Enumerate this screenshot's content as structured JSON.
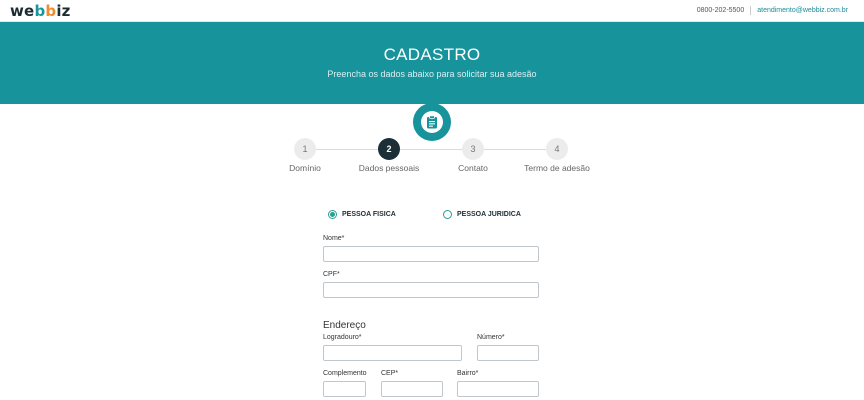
{
  "header": {
    "logo_parts": [
      "we",
      "b",
      "b",
      "iz"
    ],
    "phone": "0800-202-5500",
    "email": "atendimento@webbiz.com.br"
  },
  "hero": {
    "title": "CADASTRO",
    "subtitle": "Preencha os dados abaixo para solicitar sua adesão",
    "badge_icon": "clipboard-icon"
  },
  "steps": [
    {
      "number": "1",
      "label": "Domínio",
      "active": false
    },
    {
      "number": "2",
      "label": "Dados pessoais",
      "active": true
    },
    {
      "number": "3",
      "label": "Contato",
      "active": false
    },
    {
      "number": "4",
      "label": "Termo de adesão",
      "active": false
    }
  ],
  "person_type": {
    "options": [
      "PESSOA FISICA",
      "PESSOA JURIDICA"
    ],
    "selected": "PESSOA FISICA"
  },
  "fields": {
    "nome_label": "Nome*",
    "nome_value": "",
    "cpf_label": "CPF*",
    "cpf_value": ""
  },
  "address": {
    "title": "Endereço",
    "logradouro_label": "Logradouro*",
    "numero_label": "Número*",
    "complemento_label": "Complemento",
    "cep_label": "CEP*",
    "bairro_label": "Bairro*"
  },
  "colors": {
    "brand_teal": "#17939b",
    "dark": "#1e2e36",
    "radio_green": "#27a08f",
    "accent_orange": "#f28b2d"
  }
}
